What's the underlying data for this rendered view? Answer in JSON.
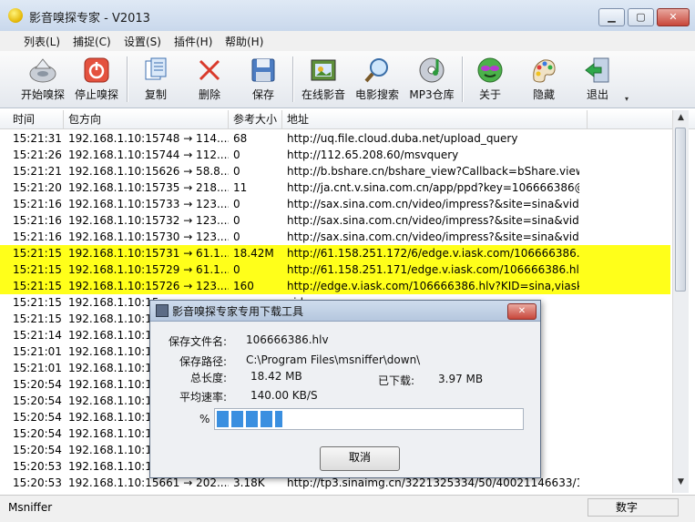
{
  "window": {
    "title": "影音嗅探专家 - V2013"
  },
  "menu": [
    "列表(L)",
    "捕捉(C)",
    "设置(S)",
    "插件(H)",
    "帮助(H)"
  ],
  "toolbar": [
    {
      "label": "开始嗅探",
      "icon": "start-sniff-icon"
    },
    {
      "label": "停止嗅探",
      "icon": "stop-sniff-icon"
    },
    {
      "label": "复制",
      "icon": "copy-icon"
    },
    {
      "label": "删除",
      "icon": "delete-icon"
    },
    {
      "label": "保存",
      "icon": "save-icon"
    },
    {
      "label": "在线影音",
      "icon": "online-media-icon"
    },
    {
      "label": "电影搜索",
      "icon": "movie-search-icon"
    },
    {
      "label": "MP3仓库",
      "icon": "mp3-store-icon"
    },
    {
      "label": "关于",
      "icon": "about-icon"
    },
    {
      "label": "隐藏",
      "icon": "hide-icon"
    },
    {
      "label": "退出",
      "icon": "exit-icon"
    }
  ],
  "columns": [
    "时间",
    "包方向",
    "参考大小",
    "地址"
  ],
  "rows": [
    {
      "time": "15:21:31",
      "dir": "192.168.1.10:15748 → 114....",
      "size": "68",
      "url": "http://uq.file.cloud.duba.net/upload_query",
      "hl": false
    },
    {
      "time": "15:21:26",
      "dir": "192.168.1.10:15744 → 112....",
      "size": "0",
      "url": "http://112.65.208.60/msvquery",
      "hl": false
    },
    {
      "time": "15:21:21",
      "dir": "192.168.1.10:15626 → 58.8...",
      "size": "0",
      "url": "http://b.bshare.cn/bshare_view?Callback=bShare.view...",
      "hl": false
    },
    {
      "time": "15:21:20",
      "dir": "192.168.1.10:15735 → 218....",
      "size": "11",
      "url": "http://ja.cnt.v.sina.com.cn/app/ppd?key=106666386@...",
      "hl": false
    },
    {
      "time": "15:21:16",
      "dir": "192.168.1.10:15733 → 123....",
      "size": "0",
      "url": "http://sax.sina.com.cn/video/impress?&site=sina&vid...",
      "hl": false
    },
    {
      "time": "15:21:16",
      "dir": "192.168.1.10:15732 → 123....",
      "size": "0",
      "url": "http://sax.sina.com.cn/video/impress?&site=sina&vid...",
      "hl": false
    },
    {
      "time": "15:21:16",
      "dir": "192.168.1.10:15730 → 123....",
      "size": "0",
      "url": "http://sax.sina.com.cn/video/impress?&site=sina&vid...",
      "hl": false
    },
    {
      "time": "15:21:15",
      "dir": "192.168.1.10:15731 → 61.1...",
      "size": "18.42M",
      "url": "http://61.158.251.172/6/edge.v.iask.com/106666386.hl...",
      "hl": true
    },
    {
      "time": "15:21:15",
      "dir": "192.168.1.10:15729 → 61.1...",
      "size": "0",
      "url": "http://61.158.251.171/edge.v.iask.com/106666386.hlv?...",
      "hl": true
    },
    {
      "time": "15:21:15",
      "dir": "192.168.1.10:15726 → 123....",
      "size": "160",
      "url": "http://edge.v.iask.com/106666386.hlv?KID=sina,viask...",
      "hl": true
    },
    {
      "time": "15:21:15",
      "dir": "192.168.1.10:15",
      "size": "",
      "url": "vid...",
      "hl": false
    },
    {
      "time": "15:21:15",
      "dir": "192.168.1.10:15",
      "size": "",
      "url": "vid...",
      "hl": false
    },
    {
      "time": "15:21:14",
      "dir": "192.168.1.10:15",
      "size": "",
      "url": "35678...",
      "hl": false
    },
    {
      "time": "15:21:01",
      "dir": "192.168.1.10:15",
      "size": "",
      "url": "ig.cur",
      "hl": false
    },
    {
      "time": "15:21:01",
      "dir": "192.168.1.10:15",
      "size": "",
      "url": "ormat...",
      "hl": false
    },
    {
      "time": "15:20:54",
      "dir": "192.168.1.10:15",
      "size": "",
      "url": "724/1",
      "hl": false
    },
    {
      "time": "15:20:54",
      "dir": "192.168.1.10:15",
      "size": "",
      "url": "84/1",
      "hl": false
    },
    {
      "time": "15:20:54",
      "dir": "192.168.1.10:15",
      "size": "",
      "url": "3/1",
      "hl": false
    },
    {
      "time": "15:20:54",
      "dir": "192.168.1.10:15",
      "size": "",
      "url": "98/0",
      "hl": false
    },
    {
      "time": "15:20:54",
      "dir": "192.168.1.10:15",
      "size": "",
      "url": "21/1",
      "hl": false
    },
    {
      "time": "15:20:53",
      "dir": "192.168.1.10:15",
      "size": "",
      "url": "50/1",
      "hl": false
    },
    {
      "time": "15:20:53",
      "dir": "192.168.1.10:15661 → 202....",
      "size": "3.18K",
      "url": "http://tp3.sinaimg.cn/3221325334/50/40021146633/1",
      "hl": false
    }
  ],
  "status": {
    "left": "Msniffer",
    "right": "数字"
  },
  "dialog": {
    "title": "影音嗅探专家专用下载工具",
    "filename_label": "保存文件名:",
    "filename": "106666386.hlv",
    "path_label": "保存路径:",
    "path": "C:\\Program Files\\msniffer\\down\\",
    "total_label": "总长度:",
    "total": "18.42 MB",
    "downloaded_label": "已下载:",
    "downloaded": "3.97 MB",
    "speed_label": "平均速率:",
    "speed": "140.00 KB/S",
    "percent_label": "%",
    "progress": 0.2155,
    "cancel": "取消"
  }
}
